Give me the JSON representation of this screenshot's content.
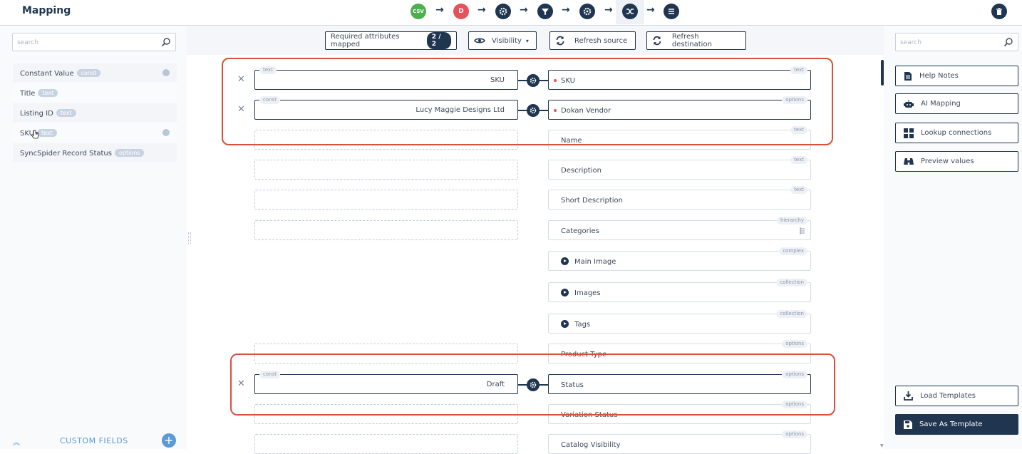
{
  "header": {
    "title": "Mapping",
    "steps": [
      {
        "label": "CSV",
        "icon": "csv-icon",
        "color": "#4caf50"
      },
      {
        "label": "D",
        "icon": "dokan-icon",
        "color": "#e8505b"
      },
      {
        "label": "",
        "icon": "gear-icon",
        "color": "#1f3550"
      },
      {
        "label": "",
        "icon": "filter-icon",
        "color": "#1f3550"
      },
      {
        "label": "",
        "icon": "gear-icon",
        "color": "#1f3550"
      },
      {
        "label": "",
        "icon": "shuffle-icon",
        "color": "#1f3550"
      },
      {
        "label": "",
        "icon": "list-icon",
        "color": "#1f3550"
      }
    ]
  },
  "left": {
    "search_placeholder": "search",
    "attributes": [
      {
        "label": "Constant Value",
        "type": "const"
      },
      {
        "label": "Title",
        "type": "text"
      },
      {
        "label": "Listing ID",
        "type": "text"
      },
      {
        "label": "SKU",
        "type": "text"
      },
      {
        "label": "SyncSpider Record Status",
        "type": "options"
      }
    ],
    "custom_fields_label": "CUSTOM FIELDS",
    "add_label": "+"
  },
  "toolbar": {
    "required_label": "Required attributes mapped",
    "required_count": "2 / 2",
    "visibility_label": "Visibility",
    "refresh_source_label": "Refresh source",
    "refresh_destination_label": "Refresh destination"
  },
  "mapping": {
    "rows": [
      {
        "source_value": "SKU",
        "source_type": "text",
        "dest": "SKU",
        "dest_type": "text",
        "required": true
      },
      {
        "source_value": "Lucy Maggie Designs Ltd",
        "source_type": "const",
        "dest": "Dokan Vendor",
        "dest_type": "options",
        "required": true
      },
      {
        "source_value": "",
        "source_type": "",
        "dest": "Name",
        "dest_type": "text",
        "required": false
      },
      {
        "source_value": "",
        "source_type": "",
        "dest": "Description",
        "dest_type": "text",
        "required": false
      },
      {
        "source_value": "",
        "source_type": "",
        "dest": "Short Description",
        "dest_type": "text",
        "required": false
      },
      {
        "source_value": "",
        "source_type": "",
        "dest": "Categories",
        "dest_type": "hierarchy",
        "required": false
      },
      {
        "source_value": "",
        "source_type": "",
        "dest": "Main Image",
        "dest_type": "complex",
        "required": false
      },
      {
        "source_value": "",
        "source_type": "",
        "dest": "Images",
        "dest_type": "collection",
        "required": false
      },
      {
        "source_value": "",
        "source_type": "",
        "dest": "Tags",
        "dest_type": "collection",
        "required": false
      },
      {
        "source_value": "",
        "source_type": "",
        "dest": "Product Type",
        "dest_type": "options",
        "required": false
      },
      {
        "source_value": "Draft",
        "source_type": "const",
        "dest": "Status",
        "dest_type": "options",
        "required": false
      },
      {
        "source_value": "",
        "source_type": "",
        "dest": "Variation Status",
        "dest_type": "options",
        "required": false
      },
      {
        "source_value": "",
        "source_type": "",
        "dest": "Catalog Visibility",
        "dest_type": "options",
        "required": false
      }
    ]
  },
  "right": {
    "search_placeholder": "search",
    "help_notes": "Help Notes",
    "ai_mapping": "AI Mapping",
    "lookup_connections": "Lookup connections",
    "preview_values": "Preview values",
    "load_templates": "Load Templates",
    "save_as_template": "Save As Template"
  },
  "colors": {
    "primary": "#1f3550",
    "accent": "#5b9bd5",
    "required_dot": "#e25a4a",
    "highlight": "#d9503f"
  }
}
